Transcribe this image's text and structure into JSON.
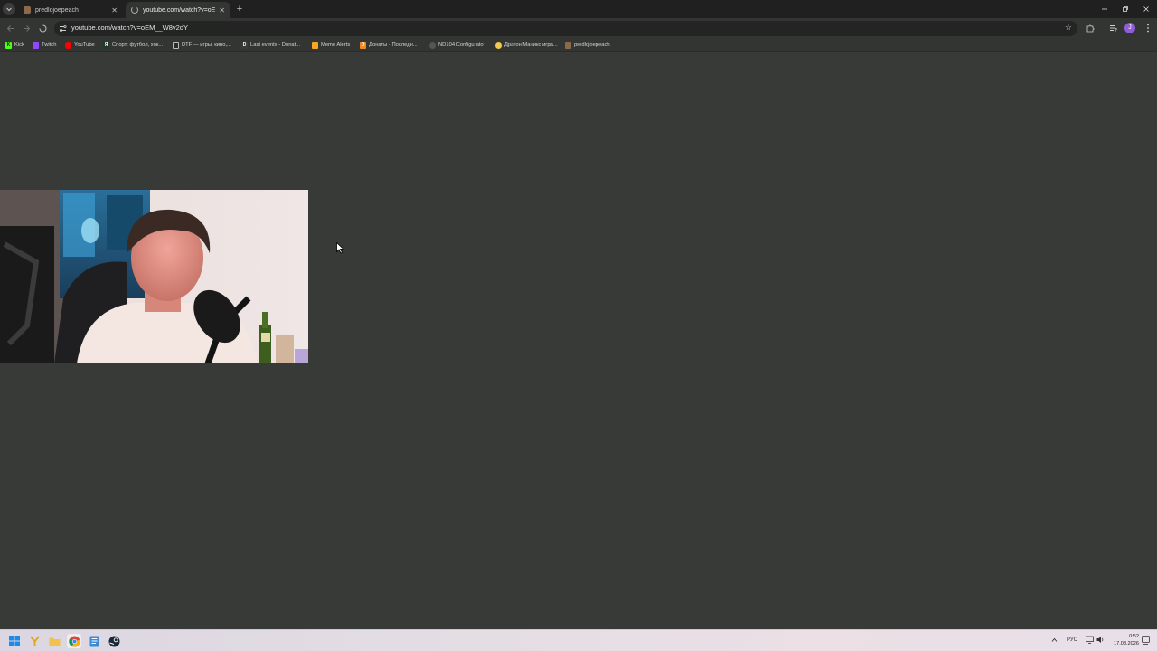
{
  "browser": {
    "tabs": [
      {
        "title": "predlojoepeach",
        "active": false
      },
      {
        "title": "youtube.com/watch?v=oEM__W",
        "active": true
      }
    ],
    "address": "youtube.com/watch?v=oEM__W8v2dY",
    "profile_initial": "J"
  },
  "bookmarks": [
    {
      "label": "Kick",
      "icon": "kick-icon",
      "color": "#53fc18"
    },
    {
      "label": "Twitch",
      "icon": "twitch-icon",
      "color": "#9146ff"
    },
    {
      "label": "YouTube",
      "icon": "youtube-icon",
      "color": "#ff0000"
    },
    {
      "label": "Спорт: футбол, хок...",
      "icon": "sports-icon",
      "color": "#1f3a2a"
    },
    {
      "label": "DTF — игры, кино,...",
      "icon": "dtf-icon",
      "color": "#2b2b2b"
    },
    {
      "label": "Last events - Donat...",
      "icon": "donationalerts-icon",
      "color": "#3a3a3a"
    },
    {
      "label": "Meme Alerts",
      "icon": "memealerts-icon",
      "color": "#f5a623"
    },
    {
      "label": "Донаты - Последн...",
      "icon": "donation-icon",
      "color": "#f08a24"
    },
    {
      "label": "ND104 Configurator",
      "icon": "configurator-icon",
      "color": "#555555"
    },
    {
      "label": "Драгон Маникс игра...",
      "icon": "dragon-icon",
      "color": "#f2c94c"
    },
    {
      "label": "predlojoepeach",
      "icon": "page-icon",
      "color": "#8a6a4a"
    }
  ],
  "taskbar": {
    "language": "РУС",
    "time": "0:52",
    "date": "17.08.2026"
  }
}
